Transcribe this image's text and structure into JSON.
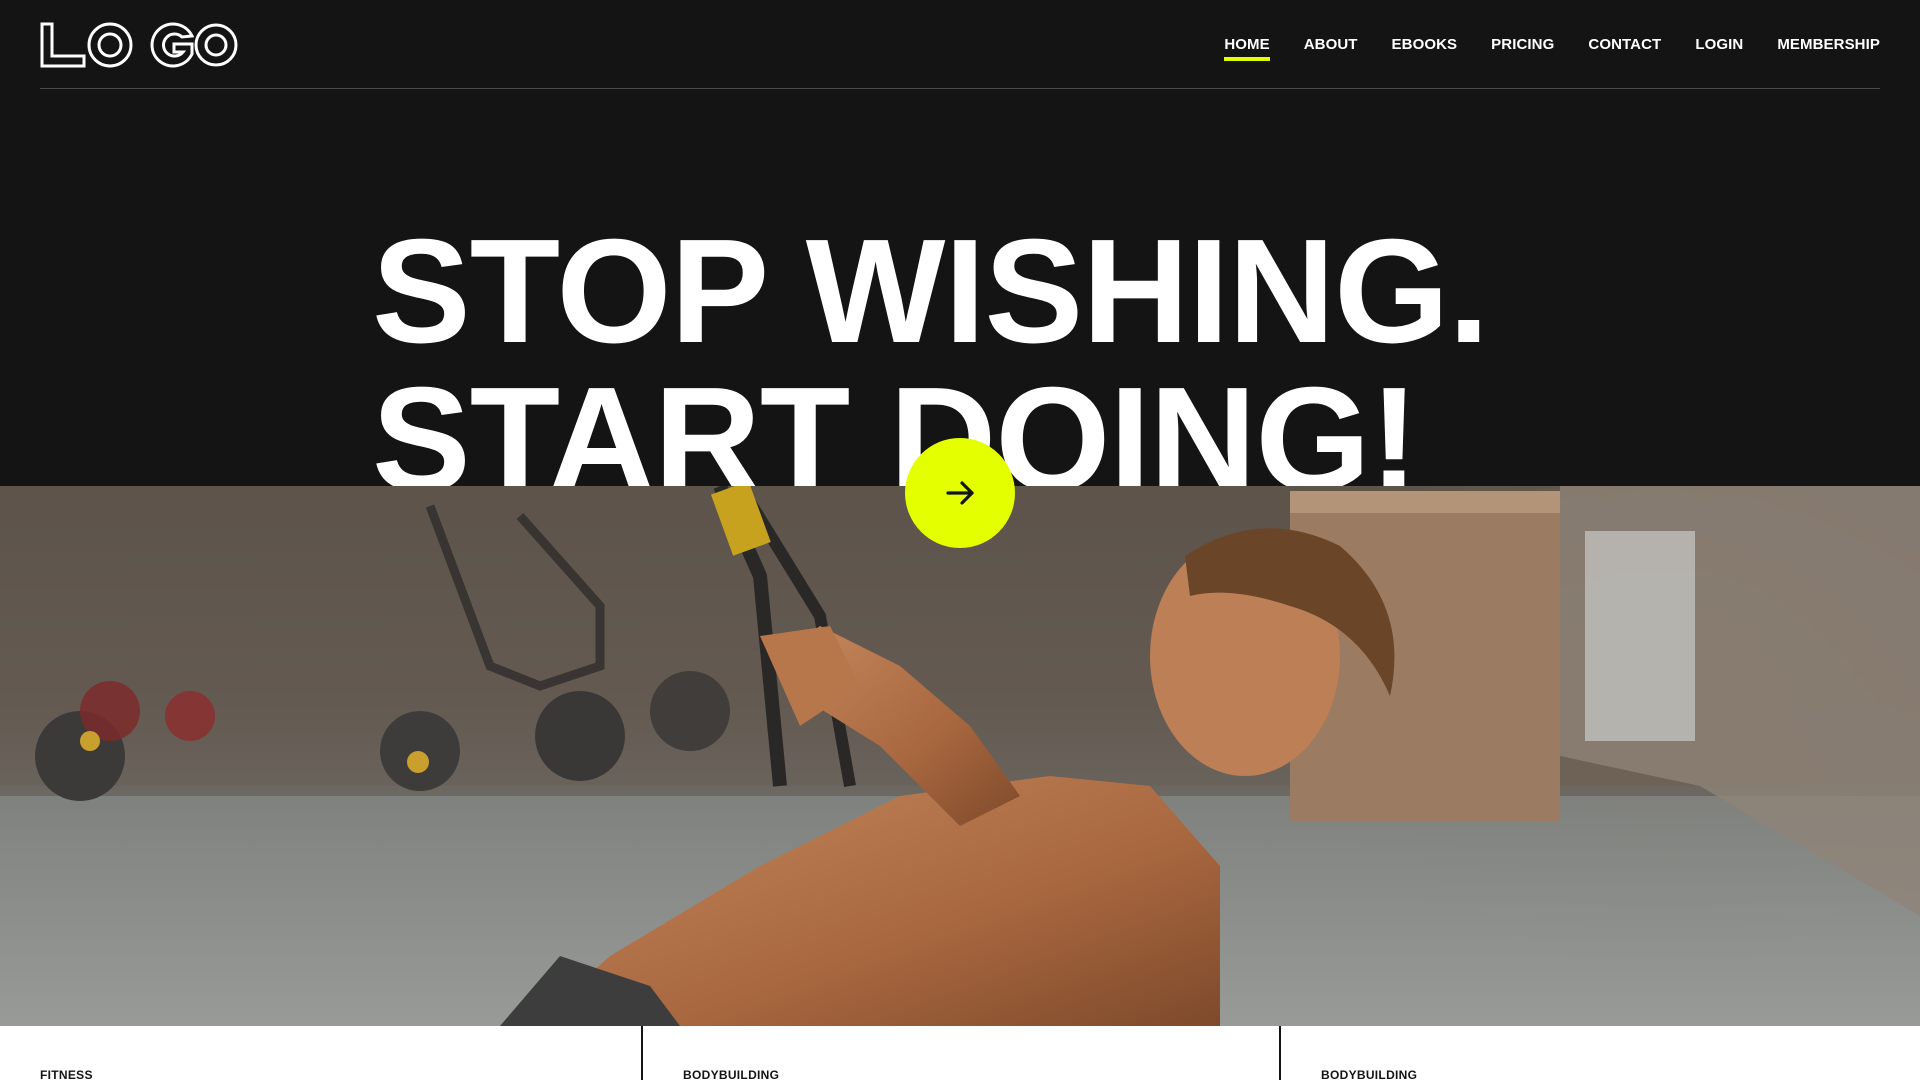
{
  "header": {
    "logo_text": "LOGO",
    "nav": [
      {
        "label": "HOME",
        "active": true
      },
      {
        "label": "ABOUT",
        "active": false
      },
      {
        "label": "EBOOKS",
        "active": false
      },
      {
        "label": "PRICING",
        "active": false
      },
      {
        "label": "CONTACT",
        "active": false
      },
      {
        "label": "LOGIN",
        "active": false
      },
      {
        "label": "MEMBERSHIP",
        "active": false
      }
    ]
  },
  "hero": {
    "headline_line1": "STOP WISHING.",
    "headline_line2": "START DOING!",
    "cta_icon": "arrow-right-icon",
    "image_description_icon": "fitness-photo"
  },
  "cards": [
    {
      "tag": "FITNESS"
    },
    {
      "tag": "BODYBUILDING"
    },
    {
      "tag": "BODYBUILDING"
    }
  ],
  "colors": {
    "background_dark": "#141414",
    "accent": "#e4ff00",
    "text_light": "#ffffff"
  }
}
